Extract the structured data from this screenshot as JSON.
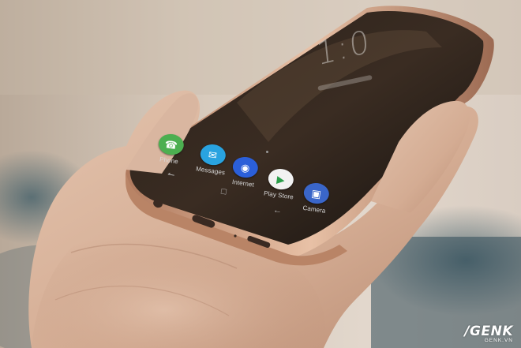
{
  "apps": [
    {
      "label": "Phone",
      "icon": "phone-icon",
      "color": "#4caf50"
    },
    {
      "label": "Messages",
      "icon": "messages-icon",
      "color": "#29a3e0"
    },
    {
      "label": "Internet",
      "icon": "internet-icon",
      "color": "#2b5fd9"
    },
    {
      "label": "Play Store",
      "icon": "play-store-icon",
      "color": "#f2f2f2"
    },
    {
      "label": "Camera",
      "icon": "camera-icon",
      "color": "#3a66c9"
    }
  ],
  "clock": {
    "time": "1:0"
  },
  "watermark": {
    "brand": "GENK",
    "site": "GENK.VN"
  },
  "colors": {
    "phone_frame": "#c89a80",
    "screen": "#1b1613",
    "skin": "#d8b49d"
  }
}
